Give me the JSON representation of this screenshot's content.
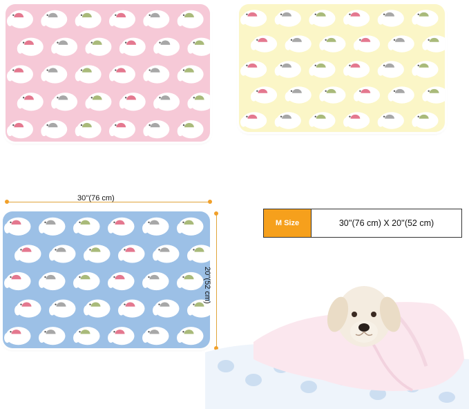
{
  "dimensions": {
    "width_label": "30''(76 cm)",
    "height_label": "20''(52 cm)"
  },
  "size_table": {
    "badge": "M Size",
    "value": "30''(76 cm) X 20''(52 cm)"
  },
  "colors": {
    "pink_blanket": "#f6c9d7",
    "yellow_blanket": "#fbf6c7",
    "blue_blanket": "#9cc0e6",
    "accent": "#f6a01c",
    "elephant_white": "#ffffff",
    "ear_pink": "#e4788f",
    "ear_green": "#a9ba7a",
    "ear_gray": "#a7a7a7"
  }
}
